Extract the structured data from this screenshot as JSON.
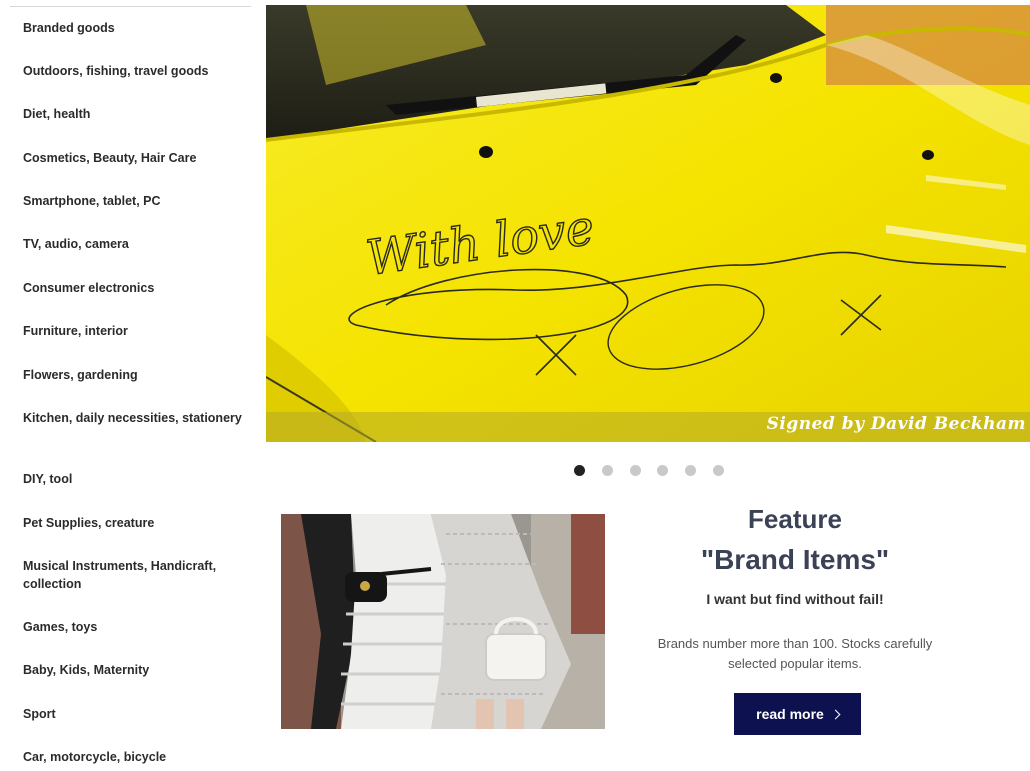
{
  "sidebar": {
    "categories": [
      {
        "label": "Branded goods"
      },
      {
        "label": "Outdoors, fishing, travel goods"
      },
      {
        "label": "Diet, health"
      },
      {
        "label": "Cosmetics, Beauty, Hair Care"
      },
      {
        "label": "Smartphone, tablet, PC"
      },
      {
        "label": "TV, audio, camera"
      },
      {
        "label": "Consumer electronics"
      },
      {
        "label": "Furniture, interior"
      },
      {
        "label": "Flowers, gardening"
      },
      {
        "label": "Kitchen, daily necessities, stationery"
      },
      {
        "label": "DIY, tool"
      },
      {
        "label": "Pet Supplies, creature"
      },
      {
        "label": "Musical Instruments, Handicraft, collection"
      },
      {
        "label": "Games, toys"
      },
      {
        "label": "Baby, Kids, Maternity"
      },
      {
        "label": "Sport"
      },
      {
        "label": "Car, motorcycle, bicycle"
      }
    ]
  },
  "hero": {
    "caption": "Signed by David Beckham",
    "handwriting": "With love",
    "slide_count": 6,
    "active_slide": 1
  },
  "feature": {
    "title_line1": "Feature",
    "title_line2": "\"Brand Items\"",
    "subtitle": "I want but find without fail!",
    "description": "Brands number more than 100. Stocks carefully selected popular items.",
    "button_label": "read more"
  },
  "colors": {
    "hero_yellow": "#f4e400",
    "button_navy": "#0d1150",
    "title_slate": "#3b4256",
    "dot_active": "#222222",
    "dot_inactive": "#c9c9c9"
  }
}
